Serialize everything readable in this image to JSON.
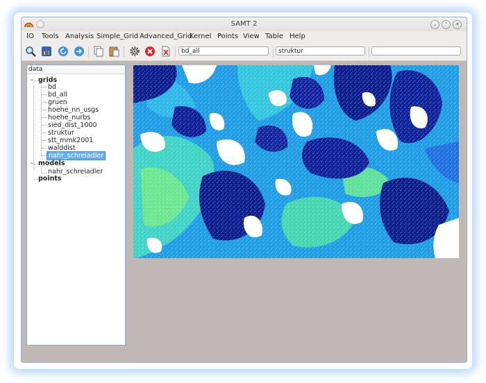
{
  "window": {
    "title": "SAMT 2"
  },
  "menu": [
    "IO",
    "Tools",
    "Analysis",
    "Simple_Grid",
    "Advanced_Grid",
    "Kernel",
    "Points",
    "View",
    "Table",
    "Help"
  ],
  "toolbar": {
    "icons": [
      "zoom-icon",
      "chart-icon",
      "refresh-icon",
      "forward-icon",
      "copy-icon",
      "paste-icon",
      "settings-gear-icon",
      "stop-icon",
      "close-document-icon"
    ],
    "field1": "bd_all",
    "field2": "struktur",
    "field3": ""
  },
  "tree": {
    "header": "data",
    "grids_label": "grids",
    "grids": [
      "bd",
      "bd_all",
      "gruen",
      "hoehe_nn_usgs",
      "hoehe_nurbs",
      "sied_dist_1000",
      "struktur",
      "stt_mmk2001",
      "walddist",
      "nahr_schreiadler"
    ],
    "selected": "nahr_schreiadler",
    "models_label": "models",
    "models": [
      "nahr_schreiadler"
    ],
    "points_label": "points"
  },
  "colors": {
    "selection": "#65aeea",
    "map_dark": "#0b1a8c",
    "map_mid": "#1f6fe0",
    "map_light": "#29c8e8",
    "map_green": "#5be08a",
    "workspace": "#bfb8b4"
  }
}
